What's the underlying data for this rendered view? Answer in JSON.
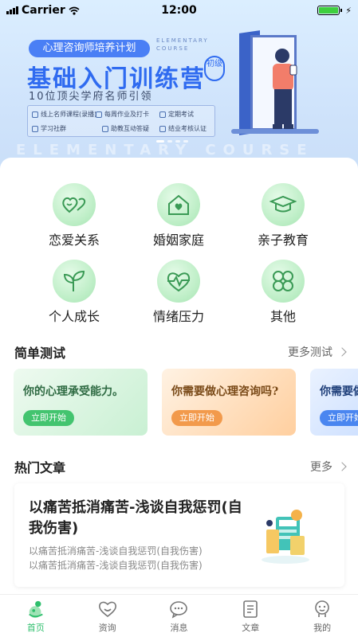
{
  "status_bar": {
    "carrier": "Carrier",
    "time": "12:00"
  },
  "banner": {
    "pill": "心理咨询师培养计划",
    "side_en": "ELEMENTARY COURSE",
    "title": "基础入门训练营",
    "badge": "初级",
    "subtitle": "10位顶尖学府名师引领",
    "features": [
      "线上名师课程(录播)",
      "每周作业及打卡",
      "定期考试",
      "学习社群",
      "助教互动答疑",
      "结业考核认证"
    ],
    "watermark": "ELEMENTARY COURSE"
  },
  "categories": [
    {
      "label": "恋爱关系",
      "icon": "hearts-icon"
    },
    {
      "label": "婚姻家庭",
      "icon": "house-heart-icon"
    },
    {
      "label": "亲子教育",
      "icon": "graduation-cap-icon"
    },
    {
      "label": "个人成长",
      "icon": "sprout-icon"
    },
    {
      "label": "情绪压力",
      "icon": "heart-pulse-icon"
    },
    {
      "label": "其他",
      "icon": "clover-icon"
    }
  ],
  "tests_section": {
    "title": "简单测试",
    "more": "更多测试"
  },
  "tests": [
    {
      "title": "你的心理承受能力。",
      "button": "立即开始",
      "color": "#43c46f"
    },
    {
      "title": "你需要做心理咨询吗?",
      "button": "立即开始",
      "color": "#f29a4c"
    },
    {
      "title": "你需要做",
      "button": "立即开始",
      "color": "#4a86f0"
    }
  ],
  "articles_section": {
    "title": "热门文章",
    "more": "更多"
  },
  "article": {
    "title": "以痛苦抵消痛苦-浅谈自我惩罚(自我伤害)",
    "summary_line1": "以痛苦抵消痛苦-浅谈自我惩罚(自我伤害)",
    "summary_line2": "以痛苦抵消痛苦-浅谈自我惩罚(自我伤害)"
  },
  "tabbar": [
    {
      "label": "首页",
      "icon": "home-icon",
      "active": true
    },
    {
      "label": "资询",
      "icon": "consult-heart-icon",
      "active": false
    },
    {
      "label": "消息",
      "icon": "chat-bubble-icon",
      "active": false
    },
    {
      "label": "文章",
      "icon": "article-icon",
      "active": false
    },
    {
      "label": "我的",
      "icon": "profile-icon",
      "active": false
    }
  ],
  "colors": {
    "accent_green": "#2fbf6d",
    "banner_blue": "#2f6bf0"
  }
}
